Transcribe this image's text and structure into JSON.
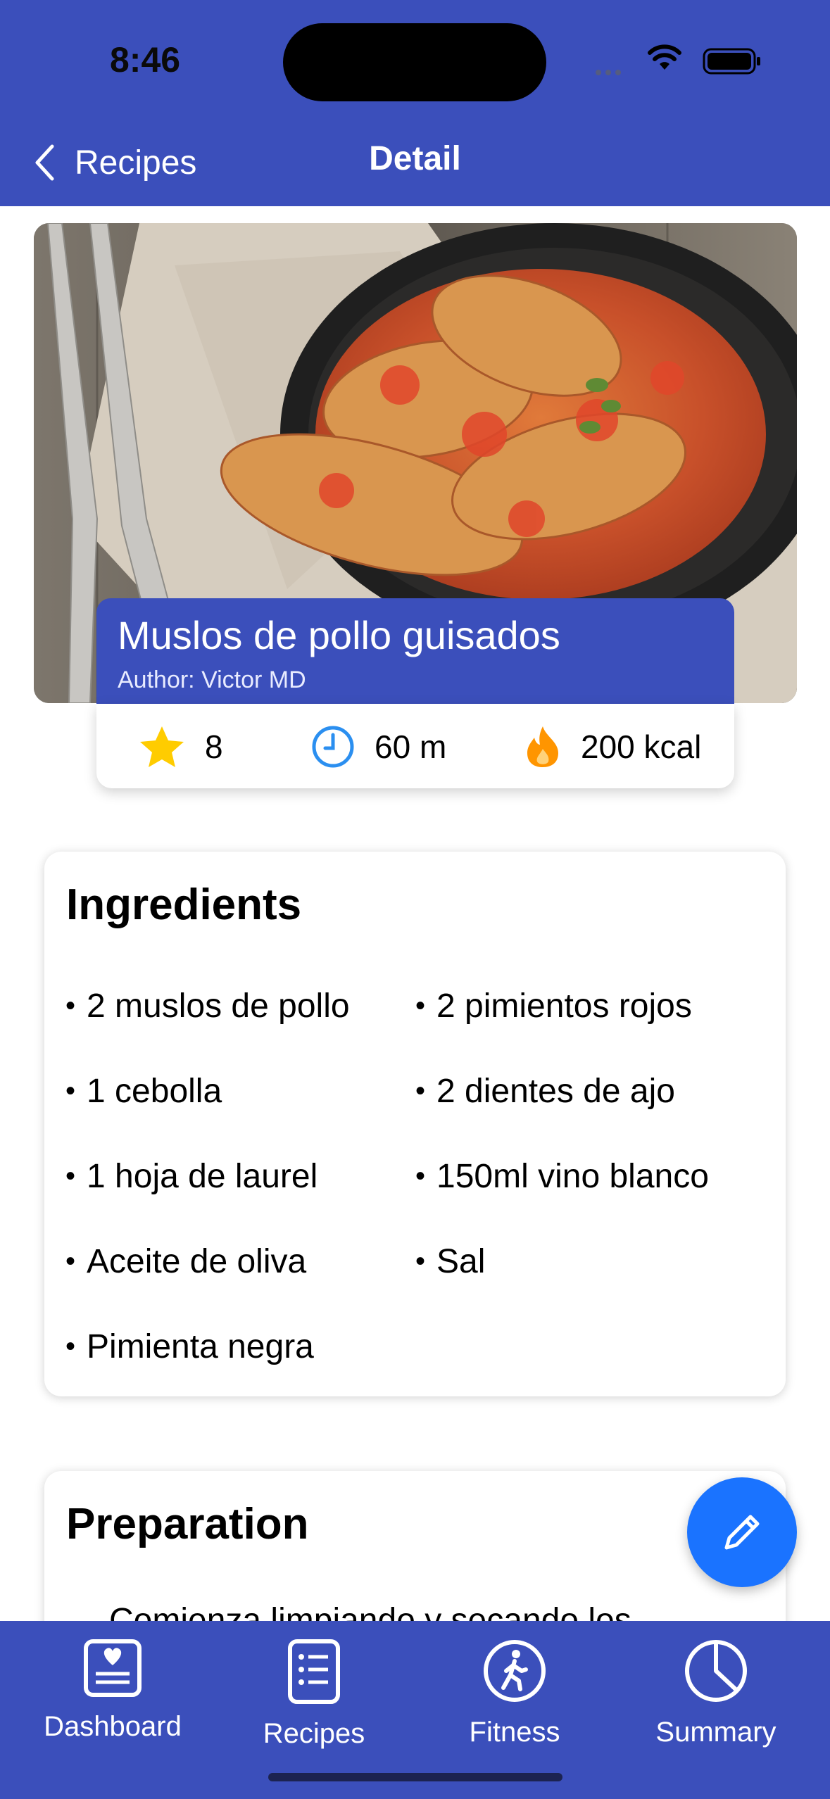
{
  "status_bar": {
    "time": "8:46"
  },
  "nav": {
    "back_label": "Recipes",
    "title": "Detail"
  },
  "recipe": {
    "title": "Muslos de pollo guisados",
    "author": "Author: Victor MD",
    "rating": "8",
    "time": "60 m",
    "calories": "200 kcal"
  },
  "ingredients": {
    "heading": "Ingredients",
    "items": [
      "2 muslos de pollo",
      "2 pimientos rojos",
      "1 cebolla",
      "2 dientes de ajo",
      "1 hoja de laurel",
      "150ml vino blanco",
      "Aceite de oliva",
      "Sal",
      "Pimienta negra"
    ]
  },
  "preparation": {
    "heading": "Preparation",
    "first_line": "Comienza limpiando y secando los"
  },
  "tabs": [
    {
      "label": "Dashboard"
    },
    {
      "label": "Recipes"
    },
    {
      "label": "Fitness"
    },
    {
      "label": "Summary"
    }
  ],
  "colors": {
    "header": "#3b4fbb",
    "fab": "#1a73ff",
    "star": "#ffcc00",
    "clock": "#2b8ff0",
    "flame": "#ff9500"
  }
}
